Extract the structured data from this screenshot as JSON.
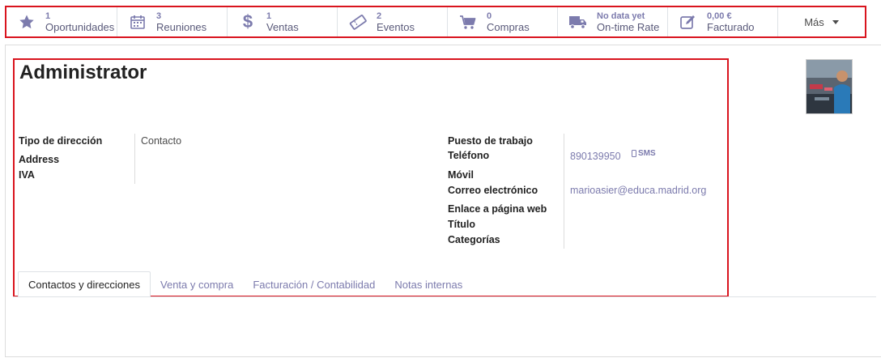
{
  "smart_buttons": [
    {
      "value": "1",
      "label": "Oportunidades",
      "icon": "star-icon"
    },
    {
      "value": "3",
      "label": "Reuniones",
      "icon": "calendar-icon"
    },
    {
      "value": "1",
      "label": "Ventas",
      "icon": "dollar-icon"
    },
    {
      "value": "2",
      "label": "Eventos",
      "icon": "ticket-icon"
    },
    {
      "value": "0",
      "label": "Compras",
      "icon": "cart-icon"
    },
    {
      "value": "No data yet",
      "label": "On-time Rate",
      "icon": "truck-icon"
    },
    {
      "value": "0,00 €",
      "label": "Facturado",
      "icon": "edit-icon"
    }
  ],
  "more_label": "Más",
  "record": {
    "name": "Administrator",
    "left_fields": {
      "address_type_label": "Tipo de dirección",
      "address_type_value": "Contacto",
      "address_label": "Address",
      "vat_label": "IVA"
    },
    "right_fields": {
      "job_label": "Puesto de trabajo",
      "phone_label": "Teléfono",
      "phone_value": "890139950",
      "sms_label": "SMS",
      "mobile_label": "Móvil",
      "email_label": "Correo electrónico",
      "email_value": "marioasier@educa.madrid.org",
      "website_label": "Enlace a página web",
      "title_label": "Título",
      "categories_label": "Categorías"
    }
  },
  "tabs": [
    {
      "label": "Contactos y direcciones",
      "active": true
    },
    {
      "label": "Venta y compra",
      "active": false
    },
    {
      "label": "Facturación / Contabilidad",
      "active": false
    },
    {
      "label": "Notas internas",
      "active": false
    }
  ],
  "colors": {
    "accent": "#7c7bad",
    "highlight_border": "#d9141e"
  }
}
